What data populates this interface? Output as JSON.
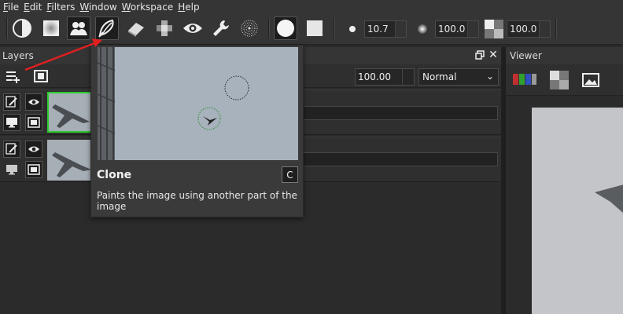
{
  "menu": [
    "File",
    "Edit",
    "Filters",
    "Window",
    "Workspace",
    "Help"
  ],
  "toolbar": {
    "tools": [
      "contrast-icon",
      "gradient-icon",
      "people-icon",
      "clone-brush-icon",
      "eraser-icon",
      "pixelate-icon",
      "eye-icon",
      "wrench-icon",
      "noise-icon",
      "circle-brush-icon",
      "square-brush-icon"
    ],
    "brush_size": "10.7",
    "hardness": "100.0",
    "opacity": "100.0"
  },
  "layers_panel": {
    "title": "Layers",
    "opacity_value": "100.00",
    "blend_mode": "Normal"
  },
  "viewer": {
    "title": "Viewer"
  },
  "tooltip": {
    "title": "Clone",
    "shortcut": "C",
    "description": "Paints the image using another part of the image"
  },
  "colors": {
    "accent_selection": "#2ccd2c",
    "annotation_arrow": "#e02020"
  }
}
